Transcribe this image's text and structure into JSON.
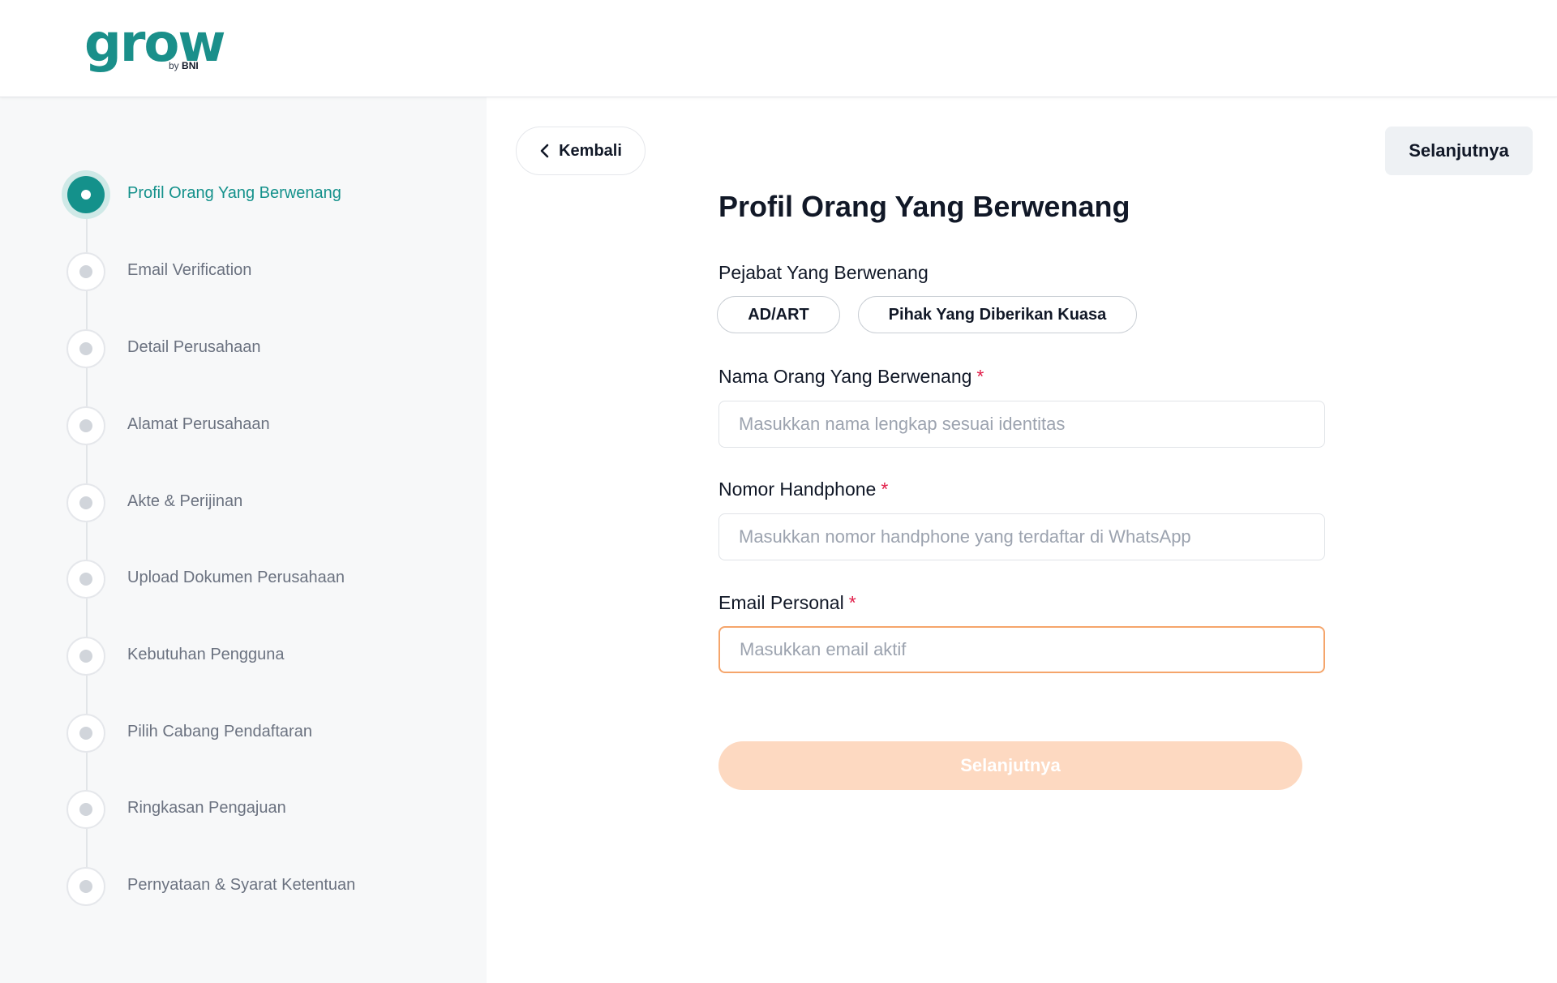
{
  "brand": {
    "name": "grow",
    "sub_prefix": "by",
    "sub_brand": "BNI",
    "color": "#1a8f8a"
  },
  "steps": [
    {
      "label": "Profil Orang Yang Berwenang",
      "active": true
    },
    {
      "label": "Email Verification",
      "active": false
    },
    {
      "label": "Detail Perusahaan",
      "active": false
    },
    {
      "label": "Alamat Perusahaan",
      "active": false
    },
    {
      "label": "Akte & Perijinan",
      "active": false
    },
    {
      "label": "Upload Dokumen Perusahaan",
      "active": false
    },
    {
      "label": "Kebutuhan Pengguna",
      "active": false
    },
    {
      "label": "Pilih Cabang Pendaftaran",
      "active": false
    },
    {
      "label": "Ringkasan Pengajuan",
      "active": false
    },
    {
      "label": "Pernyataan & Syarat Ketentuan",
      "active": false
    }
  ],
  "nav": {
    "back_label": "Kembali",
    "next_label": "Selanjutnya"
  },
  "form": {
    "title": "Profil Orang Yang Berwenang",
    "official_label": "Pejabat Yang Berwenang",
    "official_options": [
      "AD/ART",
      "Pihak Yang Diberikan Kuasa"
    ],
    "name_label": "Nama Orang Yang Berwenang",
    "name_placeholder": "Masukkan nama lengkap sesuai identitas",
    "phone_label": "Nomor Handphone",
    "phone_placeholder": "Masukkan nomor handphone yang terdaftar di WhatsApp",
    "email_label": "Email Personal",
    "email_placeholder": "Masukkan email aktif",
    "required_mark": "*",
    "submit_label": "Selanjutnya"
  },
  "colors": {
    "accent": "#14918b",
    "submit_disabled": "#fdd9c1",
    "focus_border": "#f5a56b",
    "required": "#e11d48"
  }
}
